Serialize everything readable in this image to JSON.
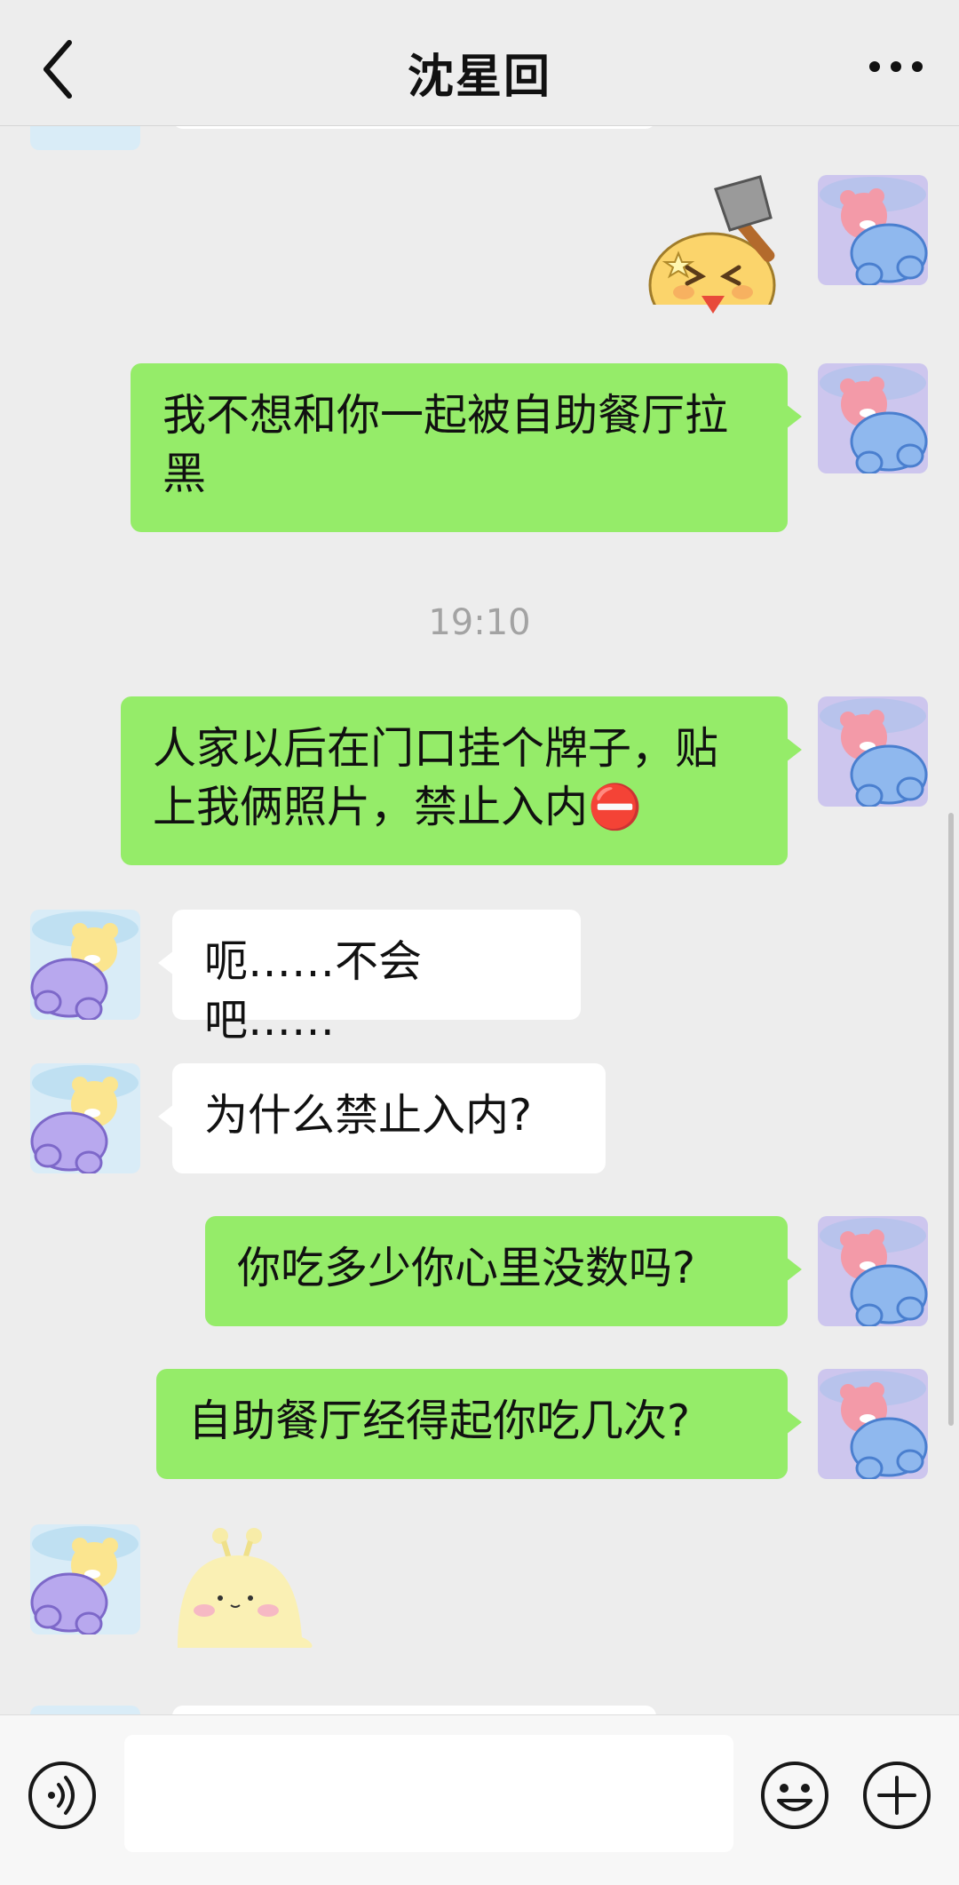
{
  "header": {
    "title": "沈星回",
    "back_icon": "chevron-left-icon",
    "more_icon": "more-dots-icon"
  },
  "messages": [
    {
      "side": "me",
      "type": "sticker",
      "sticker": "hammer-chick-sticker"
    },
    {
      "side": "me",
      "type": "text",
      "text": "我不想和你一起被自助餐厅拉黑"
    },
    {
      "type": "timestamp",
      "text": "19:10"
    },
    {
      "side": "me",
      "type": "text",
      "text": "人家以后在门口挂个牌子，贴上我俩照片，禁止入内⛔"
    },
    {
      "side": "other",
      "type": "text",
      "text": "呃……不会吧……"
    },
    {
      "side": "other",
      "type": "text",
      "text": "为什么禁止入内?"
    },
    {
      "side": "me",
      "type": "text",
      "text": "你吃多少你心里没数吗?"
    },
    {
      "side": "me",
      "type": "text",
      "text": "自助餐厅经得起你吃几次?"
    },
    {
      "side": "other",
      "type": "sticker",
      "sticker": "yellow-blob-sticker"
    }
  ],
  "input": {
    "value": ""
  },
  "colors": {
    "my_bubble": "#95ec69",
    "other_bubble": "#ffffff",
    "background": "#ededed"
  },
  "icons": {
    "voice": "voice-icon",
    "emoji": "emoji-icon",
    "plus": "plus-icon"
  }
}
